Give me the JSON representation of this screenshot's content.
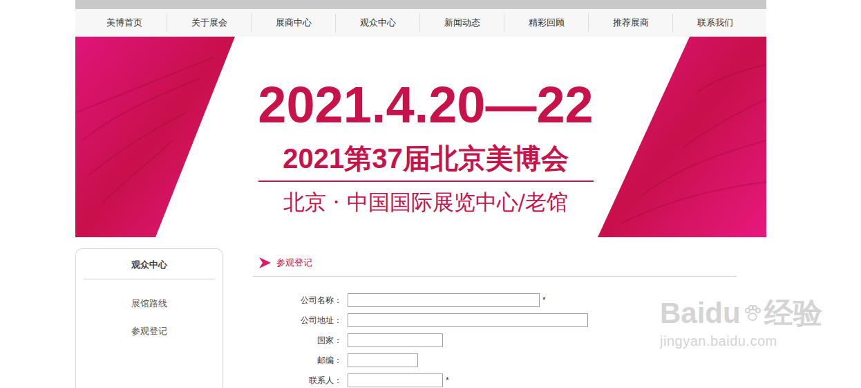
{
  "nav": [
    {
      "label": "美博首页"
    },
    {
      "label": "关于展会"
    },
    {
      "label": "展商中心"
    },
    {
      "label": "观众中心"
    },
    {
      "label": "新闻动态"
    },
    {
      "label": "精彩回顾"
    },
    {
      "label": "推荐展商"
    },
    {
      "label": "联系我们"
    }
  ],
  "banner": {
    "date": "2021.4.20—22",
    "title": "2021第37届北京美博会",
    "venue": "北京 · 中国国际展览中心/老馆"
  },
  "sidebar": {
    "title": "观众中心",
    "items": [
      {
        "label": "展馆路线"
      },
      {
        "label": "参观登记"
      }
    ]
  },
  "section": {
    "title": "参观登记"
  },
  "form": {
    "fields": [
      {
        "label": "公司名称：",
        "value": "",
        "note": "*"
      },
      {
        "label": "公司地址：",
        "value": ""
      },
      {
        "label": "国家：",
        "value": ""
      },
      {
        "label": "邮编：",
        "value": ""
      },
      {
        "label": "联系人：",
        "value": "",
        "note": "*"
      }
    ]
  },
  "watermark": {
    "brand": "Baidu",
    "suffix": "经验",
    "url": "jingyan.baidu.com"
  }
}
